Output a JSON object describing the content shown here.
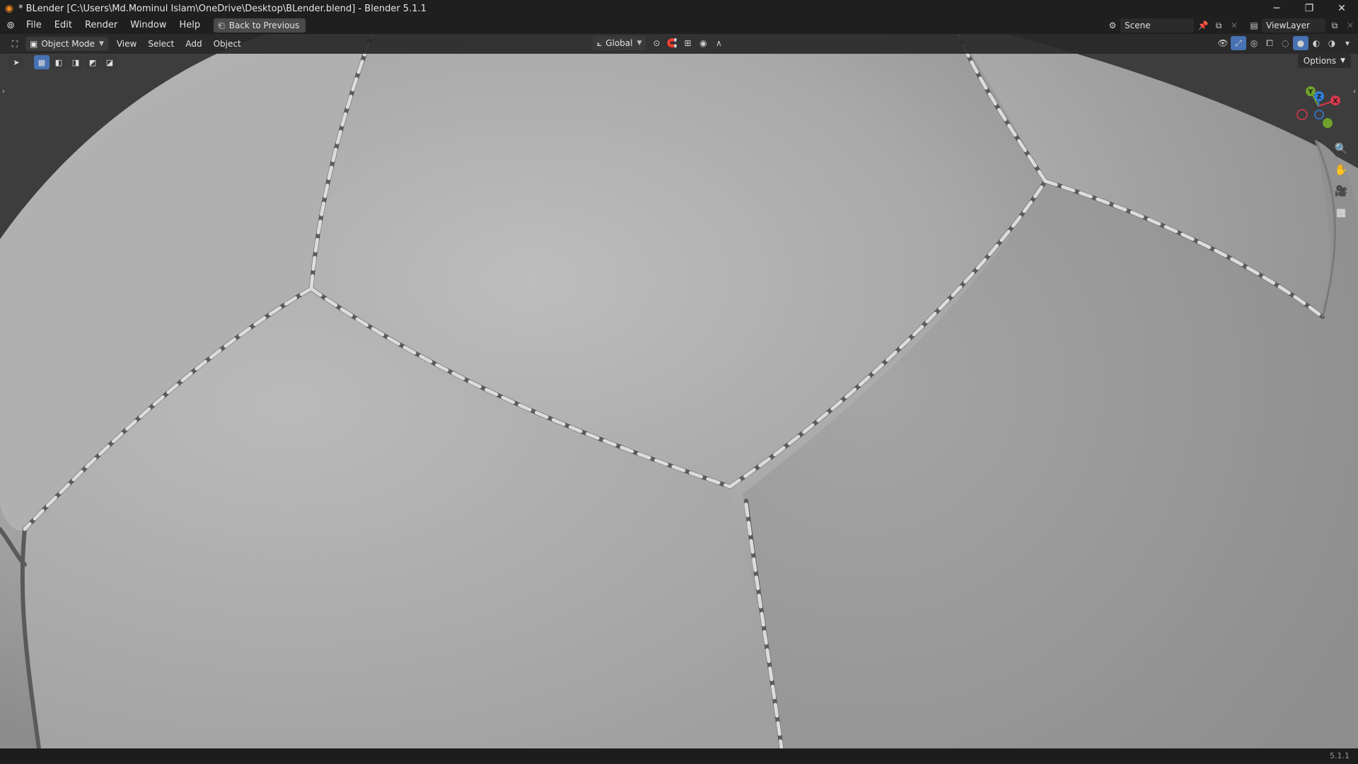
{
  "window": {
    "title": "* BLender [C:\\Users\\Md.Mominul Islam\\OneDrive\\Desktop\\BLender.blend] - Blender 5.1.1",
    "controls": {
      "minimize": "─",
      "maximize": "❐",
      "close": "✕"
    }
  },
  "menubar": {
    "items": [
      "File",
      "Edit",
      "Render",
      "Window",
      "Help"
    ],
    "back_button": "Back to Previous",
    "scene_field": "Scene",
    "view_layer_field": "ViewLayer"
  },
  "header3d": {
    "mode": "Object Mode",
    "menus": [
      "View",
      "Select",
      "Add",
      "Object"
    ],
    "transform_orientation": "Global",
    "options_label": "Options"
  },
  "gizmo": {
    "axes": {
      "x": "X",
      "y": "Y",
      "z": "Z"
    },
    "colors": {
      "x": "#d8394e",
      "y": "#6fa12c",
      "z": "#2f7fd9"
    }
  },
  "status": {
    "version": "5.1.1"
  },
  "colors": {
    "accent": "#4772b3",
    "surface": "#aeaeae"
  }
}
